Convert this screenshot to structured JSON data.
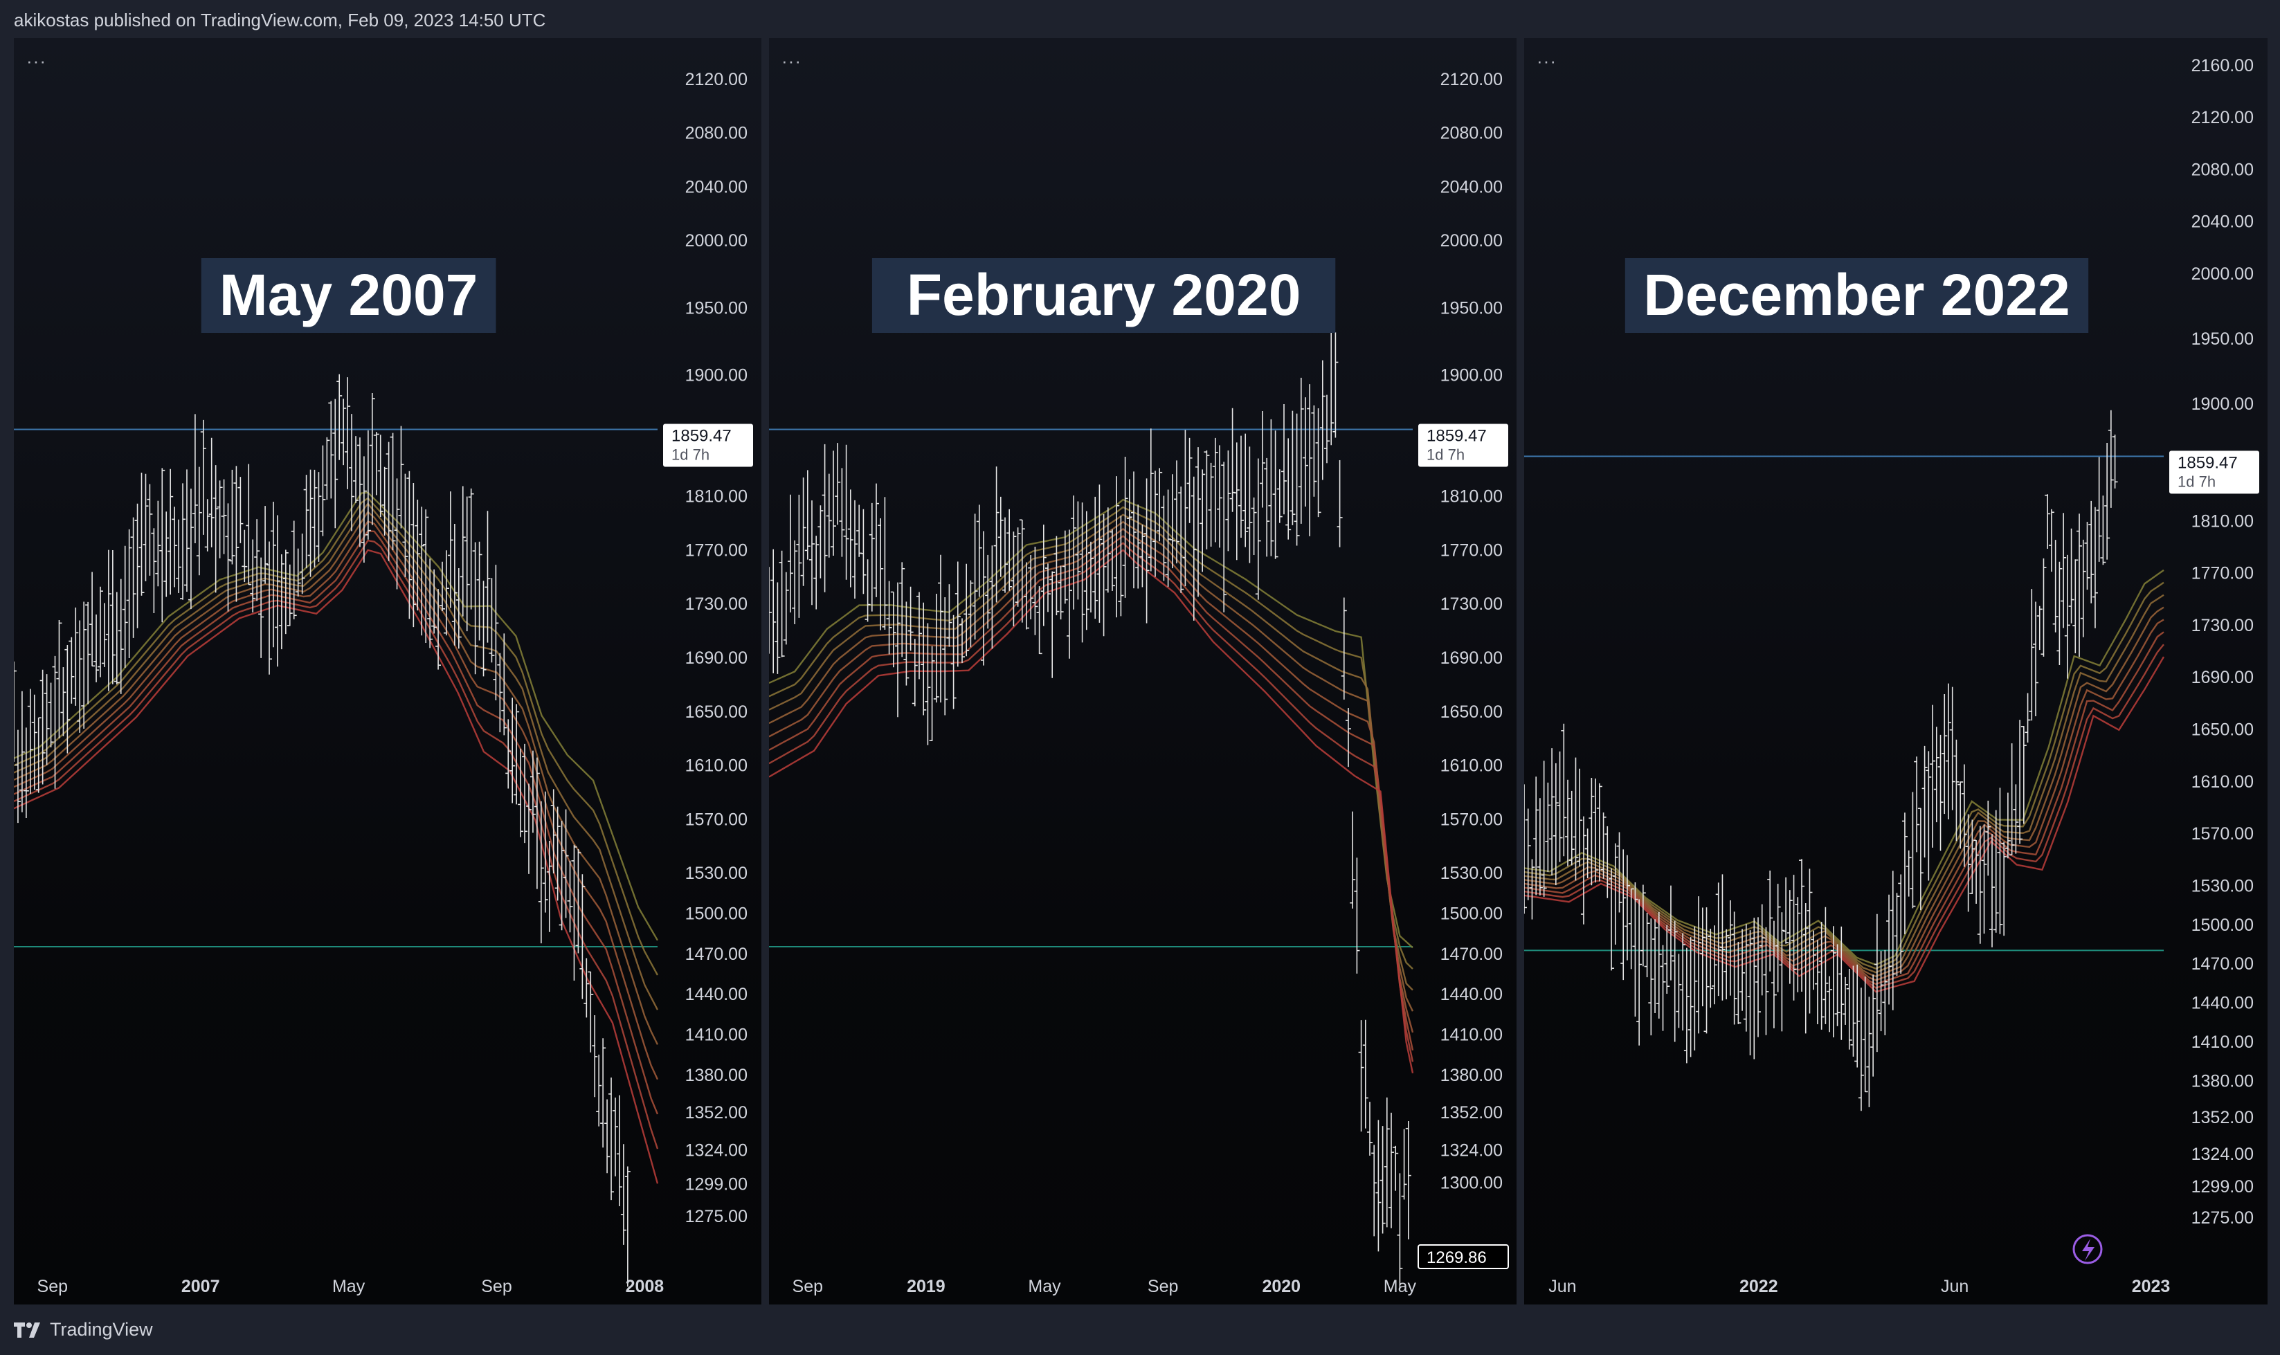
{
  "header": {
    "text": "akikostas published on TradingView.com, Feb 09, 2023 14:50 UTC"
  },
  "footer": {
    "brand": "TradingView"
  },
  "colors": {
    "background": "#1e222d",
    "resistance_line": "#3c74a8",
    "support_line": "#1e8a7a",
    "candle": "#e6e6e6",
    "ribbon_fast": "#7d7a35",
    "ribbon_slow": "#b23b37",
    "label_bg": "#223047",
    "label_text": "#ffffff",
    "axis_text": "#d1d4dc"
  },
  "chart_data": [
    {
      "type": "candlestick",
      "title": "May 2007",
      "x_ticks": [
        "Sep",
        "2007",
        "May",
        "Sep",
        "2008"
      ],
      "y_ticks": [
        "2120.00",
        "2080.00",
        "2040.00",
        "2000.00",
        "1950.00",
        "1900.00",
        "1810.00",
        "1770.00",
        "1730.00",
        "1690.00",
        "1650.00",
        "1610.00",
        "1570.00",
        "1530.00",
        "1500.00",
        "1470.00",
        "1440.00",
        "1410.00",
        "1380.00",
        "1352.00",
        "1324.00",
        "1299.00",
        "1275.00"
      ],
      "ylim": [
        1240,
        2140
      ],
      "price_tag": "1859.47",
      "countdown": "1d 7h",
      "resistance": 1859.47,
      "support": 1475,
      "trend": [
        [
          0,
          1615
        ],
        [
          0.12,
          1690
        ],
        [
          0.2,
          1770
        ],
        [
          0.28,
          1800
        ],
        [
          0.34,
          1790
        ],
        [
          0.4,
          1735
        ],
        [
          0.44,
          1760
        ],
        [
          0.5,
          1850
        ],
        [
          0.56,
          1820
        ],
        [
          0.62,
          1780
        ],
        [
          0.66,
          1730
        ],
        [
          0.7,
          1765
        ],
        [
          0.74,
          1735
        ],
        [
          0.78,
          1600
        ],
        [
          0.82,
          1550
        ],
        [
          0.86,
          1530
        ],
        [
          0.89,
          1440
        ],
        [
          0.93,
          1320
        ],
        [
          0.96,
          1275
        ]
      ],
      "ribbon_start": [
        1615,
        1570
      ],
      "ribbon_mid": [
        1795,
        1755
      ],
      "ribbon_end": [
        1590,
        1300
      ]
    },
    {
      "type": "candlestick",
      "title": "February 2020",
      "x_ticks": [
        "Sep",
        "2019",
        "May",
        "Sep",
        "2020",
        "May"
      ],
      "y_ticks": [
        "2120.00",
        "2080.00",
        "2040.00",
        "2000.00",
        "1950.00",
        "1900.00",
        "1810.00",
        "1770.00",
        "1730.00",
        "1690.00",
        "1650.00",
        "1610.00",
        "1570.00",
        "1530.00",
        "1500.00",
        "1470.00",
        "1440.00",
        "1410.00",
        "1380.00",
        "1352.00",
        "1324.00",
        "1300.00"
      ],
      "ylim": [
        1240,
        2140
      ],
      "price_tag": "1859.47",
      "countdown": "1d 7h",
      "low_tag": "1269.86",
      "resistance": 1859.47,
      "support": 1475,
      "trend": [
        [
          0,
          1710
        ],
        [
          0.05,
          1770
        ],
        [
          0.1,
          1790
        ],
        [
          0.15,
          1760
        ],
        [
          0.2,
          1720
        ],
        [
          0.24,
          1690
        ],
        [
          0.3,
          1720
        ],
        [
          0.36,
          1760
        ],
        [
          0.42,
          1740
        ],
        [
          0.5,
          1760
        ],
        [
          0.56,
          1790
        ],
        [
          0.62,
          1780
        ],
        [
          0.7,
          1800
        ],
        [
          0.78,
          1810
        ],
        [
          0.84,
          1840
        ],
        [
          0.88,
          1870
        ],
        [
          0.9,
          1620
        ],
        [
          0.92,
          1400
        ],
        [
          0.94,
          1300
        ],
        [
          1.0,
          1290
        ]
      ],
      "ribbon_start": [
        1650,
        1555
      ],
      "ribbon_mid": [
        1830,
        1790
      ],
      "ribbon_end": [
        1570,
        1410
      ]
    },
    {
      "type": "candlestick",
      "title": "December 2022",
      "x_ticks": [
        "Jun",
        "2022",
        "Jun",
        "2023"
      ],
      "y_ticks": [
        "2160.00",
        "2120.00",
        "2080.00",
        "2040.00",
        "2000.00",
        "1950.00",
        "1900.00",
        "1810.00",
        "1770.00",
        "1730.00",
        "1690.00",
        "1650.00",
        "1610.00",
        "1570.00",
        "1530.00",
        "1500.00",
        "1470.00",
        "1440.00",
        "1410.00",
        "1380.00",
        "1352.00",
        "1324.00",
        "1299.00",
        "1275.00"
      ],
      "ylim": [
        1240,
        2170
      ],
      "price_tag": "1859.47",
      "countdown": "1d 7h",
      "resistance": 1859.47,
      "support": 1480,
      "trend": [
        [
          0,
          1540
        ],
        [
          0.05,
          1590
        ],
        [
          0.1,
          1570
        ],
        [
          0.15,
          1510
        ],
        [
          0.2,
          1470
        ],
        [
          0.26,
          1450
        ],
        [
          0.32,
          1490
        ],
        [
          0.36,
          1450
        ],
        [
          0.42,
          1510
        ],
        [
          0.48,
          1440
        ],
        [
          0.54,
          1420
        ],
        [
          0.58,
          1500
        ],
        [
          0.62,
          1570
        ],
        [
          0.66,
          1640
        ],
        [
          0.7,
          1560
        ],
        [
          0.74,
          1520
        ],
        [
          0.78,
          1640
        ],
        [
          0.82,
          1800
        ],
        [
          0.86,
          1740
        ],
        [
          0.9,
          1800
        ],
        [
          0.93,
          1850
        ]
      ],
      "ribbon_start": [
        1545,
        1525
      ],
      "ribbon_mid": [
        1490,
        1465
      ],
      "ribbon_end": [
        1730,
        1640
      ]
    }
  ]
}
